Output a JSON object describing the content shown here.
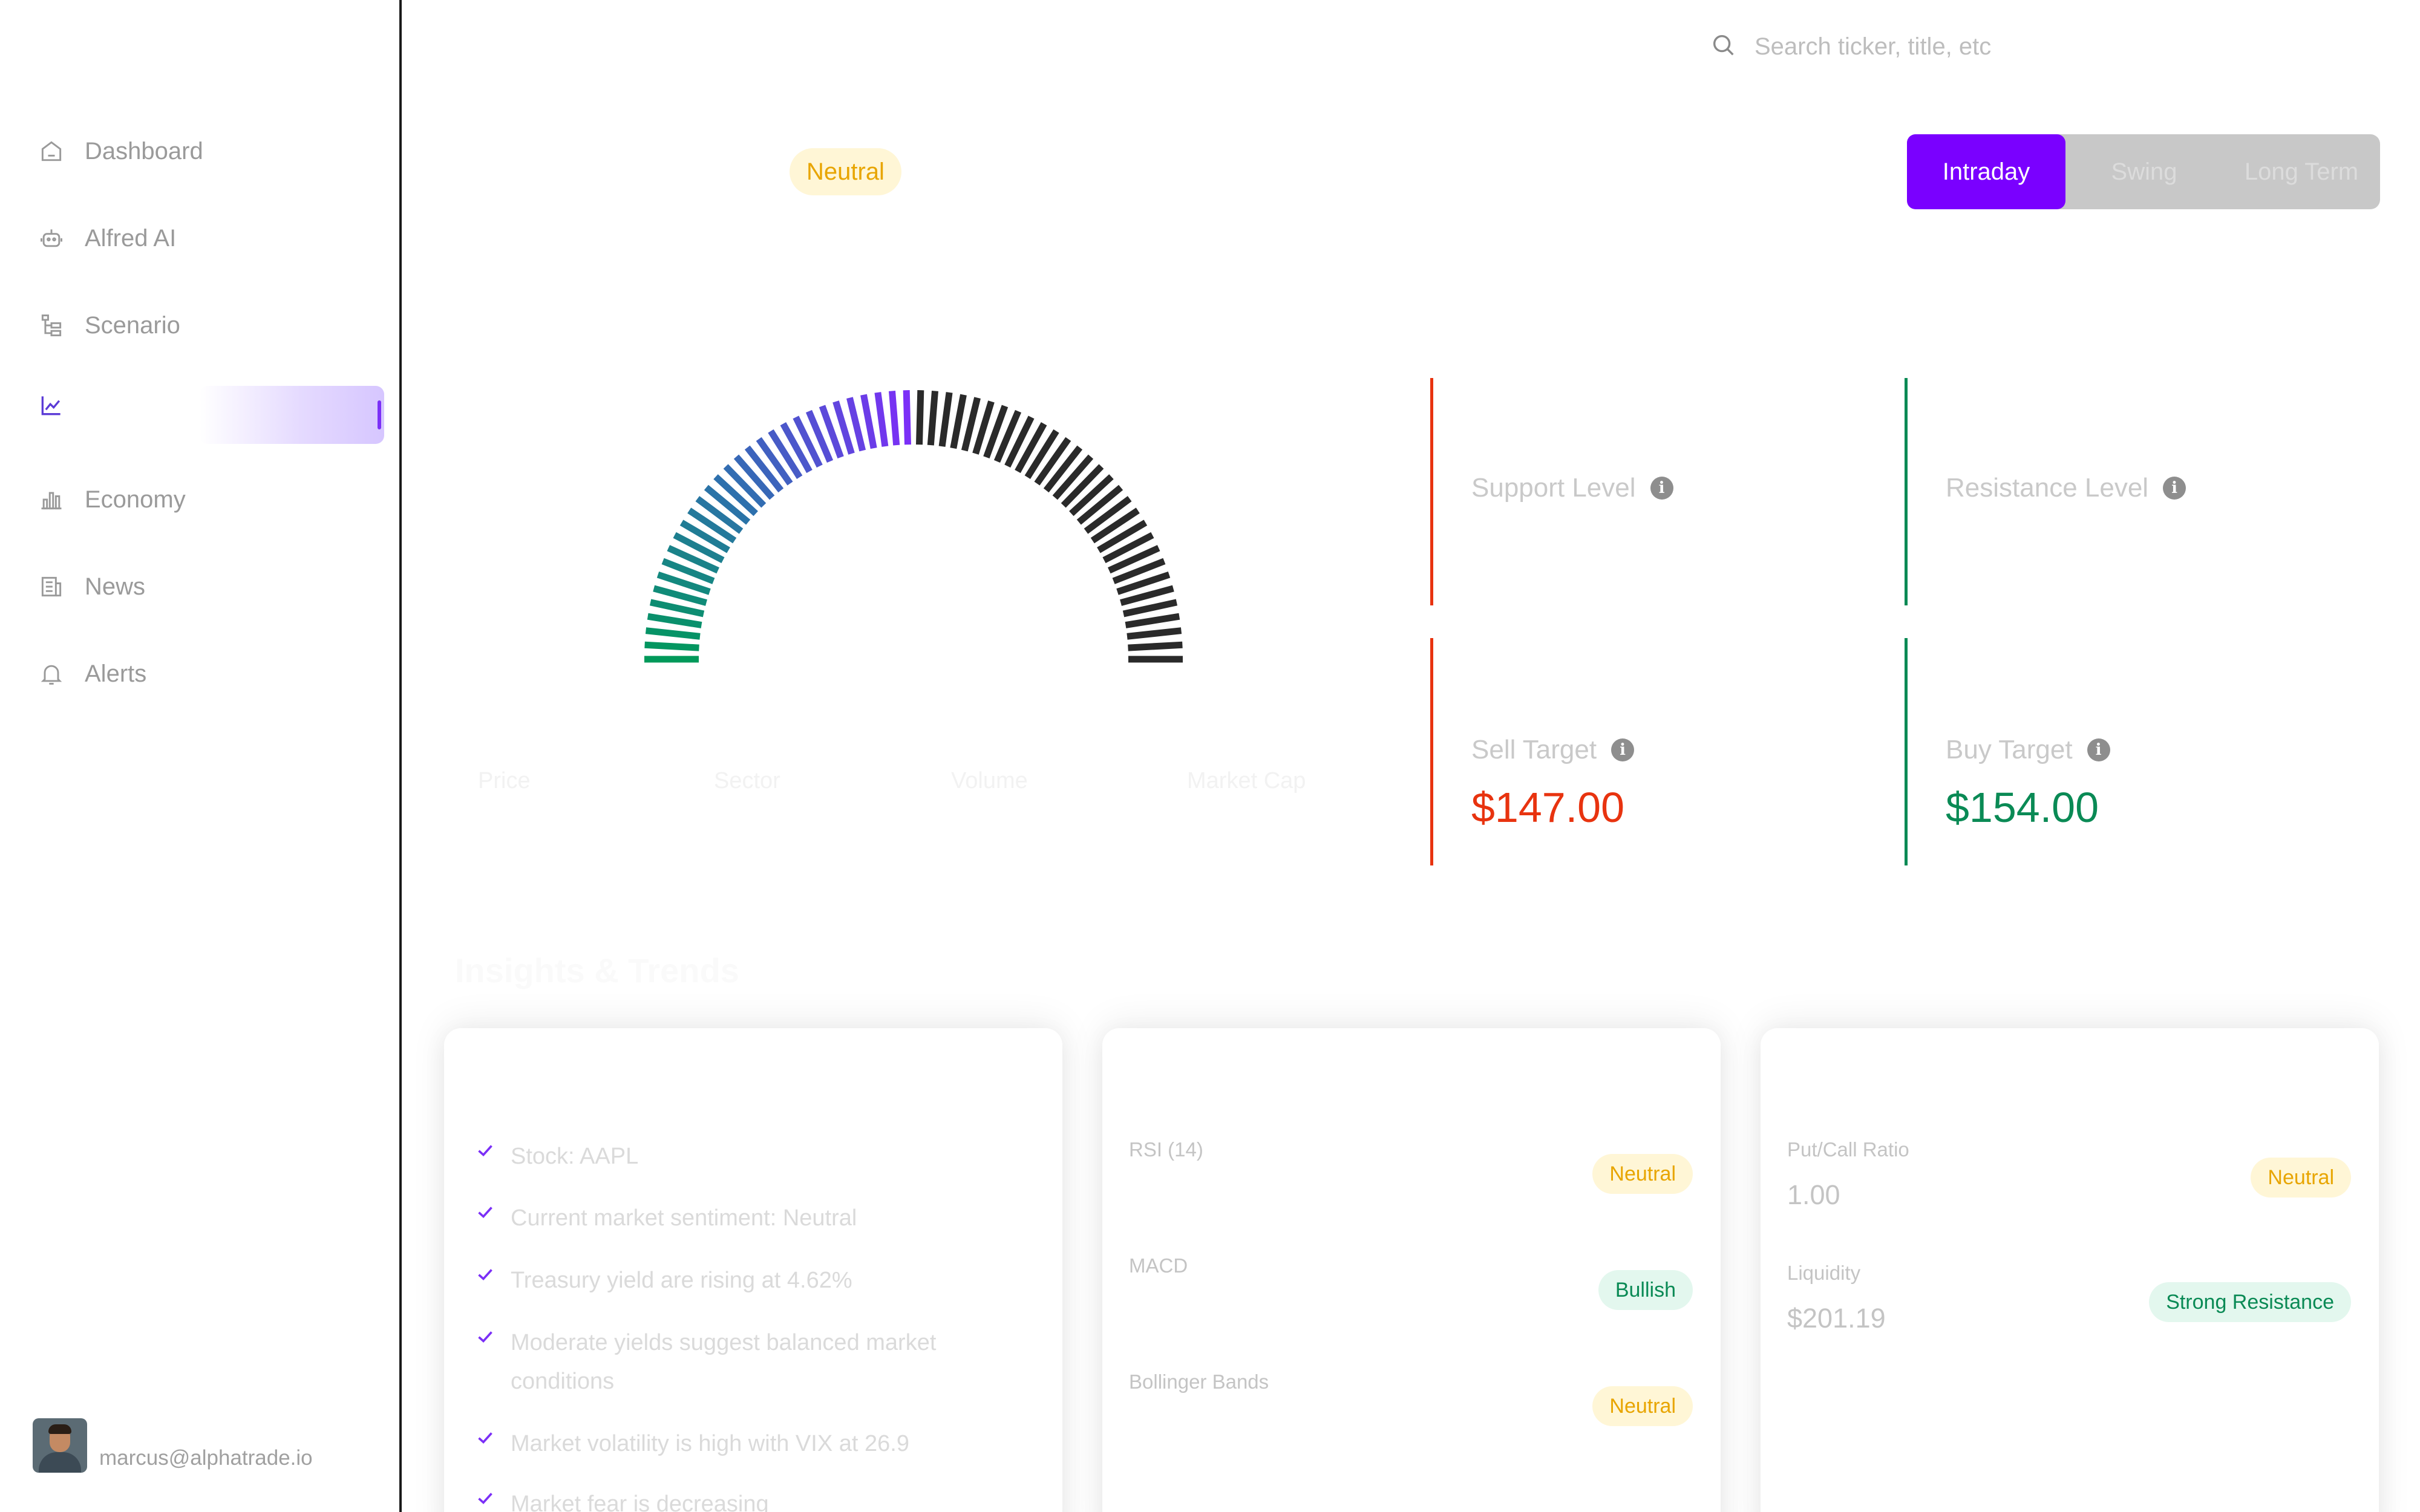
{
  "sidebar": {
    "items": [
      {
        "label": "Dashboard",
        "icon": "home-icon"
      },
      {
        "label": "Alfred AI",
        "icon": "robot-icon"
      },
      {
        "label": "Scenario",
        "icon": "tree-icon"
      },
      {
        "label": "",
        "icon": "chart-line-icon",
        "active": true
      },
      {
        "label": "Economy",
        "icon": "bar-chart-icon"
      },
      {
        "label": "News",
        "icon": "newspaper-icon"
      },
      {
        "label": "Alerts",
        "icon": "bell-icon"
      }
    ],
    "user_email": "marcus@alphatrade.io"
  },
  "search": {
    "placeholder": "Search ticker, title, etc"
  },
  "sentiment": {
    "badge": "Neutral"
  },
  "timeframe": {
    "options": [
      "Intraday",
      "Swing",
      "Long Term"
    ],
    "selected": "Intraday"
  },
  "gauge": {
    "level": 0.5,
    "colors": {
      "bearish": "#00995a",
      "mid": "#2f6fb0",
      "accent": "#7b2ff7",
      "rest": "#2a2a2a"
    }
  },
  "stats": {
    "labels": [
      "Price",
      "Sector",
      "Volume",
      "Market Cap"
    ]
  },
  "levels": {
    "support": {
      "title": "Support Level"
    },
    "resistance": {
      "title": "Resistance Level"
    },
    "sell": {
      "title": "Sell Target",
      "value": "$147.00",
      "color": "#e8330f"
    },
    "buy": {
      "title": "Buy Target",
      "value": "$154.00",
      "color": "#0a8a55"
    }
  },
  "insights_section": {
    "title": "Insights & Trends"
  },
  "insights": [
    "Stock: AAPL",
    "Current market sentiment: Neutral",
    "Treasury yield are rising at 4.62%",
    "Moderate yields suggest balanced market conditions",
    "Market volatility is high with VIX at 26.9",
    "Market fear is decreasing"
  ],
  "technical": [
    {
      "label": "RSI (14)",
      "status": "Neutral"
    },
    {
      "label": "MACD",
      "status": "Bullish"
    },
    {
      "label": "Bollinger Bands",
      "status": "Neutral"
    }
  ],
  "options_card": [
    {
      "label": "Put/Call Ratio",
      "value": "1.00",
      "status": "Neutral"
    },
    {
      "label": "Liquidity",
      "value": "$201.19",
      "status": "Strong Resistance"
    }
  ]
}
